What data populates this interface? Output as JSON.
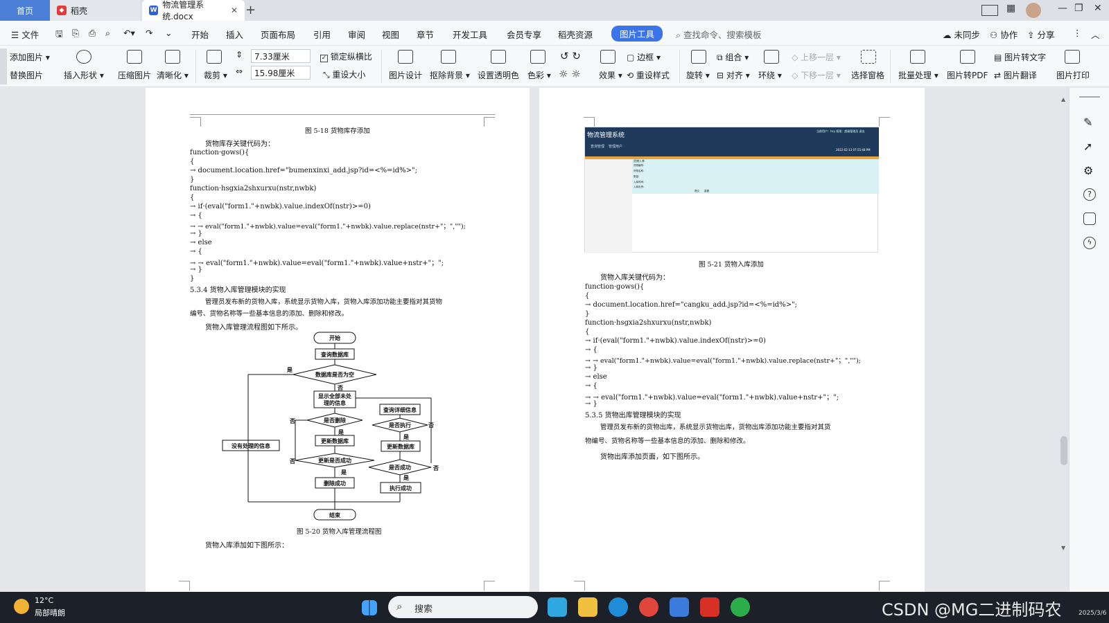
{
  "tabs": {
    "home": "首页",
    "daoke": "稻壳",
    "doc": "物流管理系统.docx",
    "add": "+"
  },
  "menu": {
    "file": "文件",
    "items": [
      "开始",
      "插入",
      "页面布局",
      "引用",
      "审阅",
      "视图",
      "章节",
      "开发工具",
      "会员专享",
      "稻壳资源"
    ],
    "active": "图片工具",
    "search": "查找命令、搜索模板",
    "unsync": "未同步",
    "collab": "协作",
    "share": "分享"
  },
  "ribbon": {
    "add_image": "添加图片",
    "replace_image": "替换图片",
    "insert_shape": "插入形状",
    "compress": "压缩图片",
    "clarity": "清晰化",
    "crop": "裁剪",
    "width_value": "7.33厘米",
    "height_value": "15.98厘米",
    "lock_ratio": "锁定纵横比",
    "reset_size": "重设大小",
    "image_design": "图片设计",
    "remove_bg": "抠除背景",
    "transparency": "设置透明色",
    "color": "色彩",
    "effect": "效果",
    "border": "边框",
    "reset_style": "重设样式",
    "rotate": "旋转",
    "group": "组合",
    "align": "对齐",
    "wrap": "环绕",
    "bring_forward": "上移一层",
    "send_backward": "下移一层",
    "selection_pane": "选择窗格",
    "batch": "批量处理",
    "to_pdf": "图片转PDF",
    "to_text": "图片转文字",
    "translate": "图片翻译",
    "print": "图片打印"
  },
  "page_left": {
    "fig18_caption": "图 5-18 货物库存添加",
    "code_intro": "货物库存关键代码为：",
    "code": [
      "function·gows(){",
      "{",
      "→ document.location.href=\"bumenxinxi_add.jsp?id=<%=id%>\";",
      "}",
      "function·hsgxia2shxurxu(nstr,nwbk)",
      "{",
      "→ if·(eval(\"form1.\"+nwbk).value.indexOf(nstr)>=0)",
      "→ {",
      "→ → eval(\"form1.\"+nwbk).value=eval(\"form1.\"+nwbk).value.replace(nstr+\"；\",\"\");",
      "→ }",
      "→ else",
      "→ {",
      "→ → eval(\"form1.\"+nwbk).value=eval(\"form1.\"+nwbk).value+nstr+\"；\";",
      "→ }",
      "}"
    ],
    "section": "5.3.4 货物入库管理模块的实现",
    "para1": "管理员发布新的货物入库，系统显示货物入库，货物入库添加功能主要指对其货物",
    "para2": "编号、货物名称等一些基本信息的添加、删除和修改。",
    "flow_intro": "货物入库管理流程图如下所示。",
    "fig20_caption": "图 5-20 货物入库管理流程图",
    "add_intro": "货物入库添加如下图所示：",
    "flow": {
      "start": "开始",
      "query_db": "查询数据库",
      "db_empty": "数据库是否为空",
      "show_all_1": "显示全部未处",
      "show_all_2": "理的信息",
      "query_detail": "查询详细信息",
      "is_delete": "是否删除",
      "is_execute": "是否执行",
      "no_info": "没有处理的信息",
      "update_db": "更新数据库",
      "update_db2": "更新数据库",
      "update_ok": "更新是否成功",
      "is_success": "是否成功",
      "delete_ok": "删除成功",
      "exec_ok": "执行成功",
      "end": "结束",
      "yes": "是",
      "no": "否"
    }
  },
  "page_right": {
    "screenshot": {
      "title": "物流管理系统",
      "btn1": "查询管理",
      "btn2": "管理用户",
      "user_info": "当前用户：hsy 权限：超级管理员 退出",
      "datetime": "2022-02-13 07:55:48 PM",
      "form_title": "货物入库",
      "fields": [
        "货物编号：",
        "货物名称：",
        "数量：",
        "入库时间：",
        "入库负责："
      ],
      "btn_submit": "提交",
      "btn_reset": "重置"
    },
    "fig21_caption": "图 5-21 货物入库添加",
    "code_intro": "货物入库关键代码为：",
    "code": [
      "function·gows(){",
      "{",
      "→ document.location.href=\"cangku_add.jsp?id=<%=id%>\";",
      "}",
      "function·hsgxia2shxurxu(nstr,nwbk)",
      "{",
      "→ if·(eval(\"form1.\"+nwbk).value.indexOf(nstr)>=0)",
      "→ {",
      "→ → eval(\"form1.\"+nwbk).value=eval(\"form1.\"+nwbk).value.replace(nstr+\"；\",\"\");",
      "→ }",
      "→ else",
      "→ {",
      "→ → eval(\"form1.\"+nwbk).value=eval(\"form1.\"+nwbk).value+nstr+\"；\";",
      "→ }"
    ],
    "section": "5.3.5 货物出库管理模块的实现",
    "para1": "管理员发布新的货物出库，系统显示货物出库，货物出库添加功能主要指对其货",
    "para2": "物编号、货物名称等一些基本信息的添加、删除和修改。",
    "add_intro": "货物出库添加页面，如下图所示。"
  },
  "taskbar": {
    "temp": "12°C",
    "weather": "局部晴朗",
    "search": "搜索",
    "watermark": "CSDN @MG二进制码农",
    "date": "2025/3/6"
  }
}
